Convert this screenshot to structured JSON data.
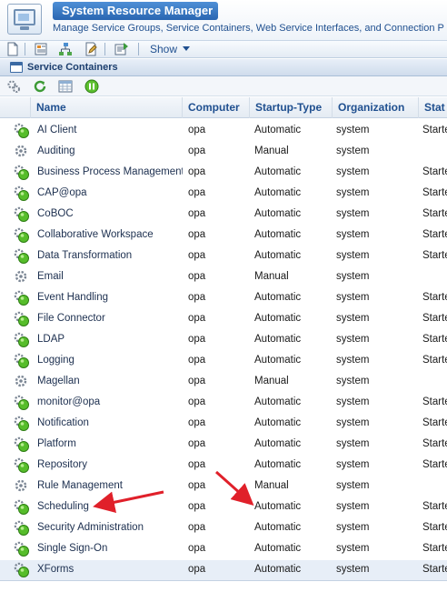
{
  "app": {
    "title": "System Resource Manager",
    "subtitle": "Manage Service Groups, Service Containers, Web Service Interfaces, and Connection P"
  },
  "toolbar": {
    "icons": [
      "new-document-icon",
      "properties-icon",
      "hierarchy-icon",
      "edit-document-icon",
      "export-icon"
    ],
    "show_label": "Show"
  },
  "panel": {
    "title": "Service Containers",
    "actions": [
      "gears-icon",
      "refresh-icon",
      "grid-view-icon",
      "pause-icon"
    ]
  },
  "colors": {
    "accent": "#2a66b1",
    "status_green": "#3cae2a",
    "annotation_red": "#e0202a"
  },
  "table": {
    "columns": [
      "Name",
      "Computer",
      "Startup-Type",
      "Organization",
      "Stat"
    ],
    "rows": [
      {
        "icon": "running",
        "name": "AI Client",
        "computer": "opa",
        "startup": "Automatic",
        "org": "system",
        "status": "Starte"
      },
      {
        "icon": "stopped",
        "name": "Auditing",
        "computer": "opa",
        "startup": "Manual",
        "org": "system",
        "status": ""
      },
      {
        "icon": "running",
        "name": "Business Process Management",
        "computer": "opa",
        "startup": "Automatic",
        "org": "system",
        "status": "Starte"
      },
      {
        "icon": "running",
        "name": "CAP@opa",
        "computer": "opa",
        "startup": "Automatic",
        "org": "system",
        "status": "Starte"
      },
      {
        "icon": "running",
        "name": "CoBOC",
        "computer": "opa",
        "startup": "Automatic",
        "org": "system",
        "status": "Starte"
      },
      {
        "icon": "running",
        "name": "Collaborative Workspace",
        "computer": "opa",
        "startup": "Automatic",
        "org": "system",
        "status": "Starte"
      },
      {
        "icon": "running",
        "name": "Data Transformation",
        "computer": "opa",
        "startup": "Automatic",
        "org": "system",
        "status": "Starte"
      },
      {
        "icon": "stopped",
        "name": "Email",
        "computer": "opa",
        "startup": "Manual",
        "org": "system",
        "status": ""
      },
      {
        "icon": "running",
        "name": "Event Handling",
        "computer": "opa",
        "startup": "Automatic",
        "org": "system",
        "status": "Starte"
      },
      {
        "icon": "running",
        "name": "File Connector",
        "computer": "opa",
        "startup": "Automatic",
        "org": "system",
        "status": "Starte"
      },
      {
        "icon": "running",
        "name": "LDAP",
        "computer": "opa",
        "startup": "Automatic",
        "org": "system",
        "status": "Starte"
      },
      {
        "icon": "running",
        "name": "Logging",
        "computer": "opa",
        "startup": "Automatic",
        "org": "system",
        "status": "Starte"
      },
      {
        "icon": "stopped",
        "name": "Magellan",
        "computer": "opa",
        "startup": "Manual",
        "org": "system",
        "status": ""
      },
      {
        "icon": "running",
        "name": "monitor@opa",
        "computer": "opa",
        "startup": "Automatic",
        "org": "system",
        "status": "Starte"
      },
      {
        "icon": "running",
        "name": "Notification",
        "computer": "opa",
        "startup": "Automatic",
        "org": "system",
        "status": "Starte"
      },
      {
        "icon": "running",
        "name": "Platform",
        "computer": "opa",
        "startup": "Automatic",
        "org": "system",
        "status": "Starte"
      },
      {
        "icon": "running",
        "name": "Repository",
        "computer": "opa",
        "startup": "Automatic",
        "org": "system",
        "status": "Starte"
      },
      {
        "icon": "stopped",
        "name": "Rule Management",
        "computer": "opa",
        "startup": "Manual",
        "org": "system",
        "status": ""
      },
      {
        "icon": "running",
        "name": "Scheduling",
        "computer": "opa",
        "startup": "Automatic",
        "org": "system",
        "status": "Starte"
      },
      {
        "icon": "running",
        "name": "Security Administration",
        "computer": "opa",
        "startup": "Automatic",
        "org": "system",
        "status": "Starte"
      },
      {
        "icon": "running",
        "name": "Single Sign-On",
        "computer": "opa",
        "startup": "Automatic",
        "org": "system",
        "status": "Starte"
      },
      {
        "icon": "running",
        "name": "XForms",
        "computer": "opa",
        "startup": "Automatic",
        "org": "system",
        "status": "Starte",
        "selected": true
      }
    ]
  }
}
